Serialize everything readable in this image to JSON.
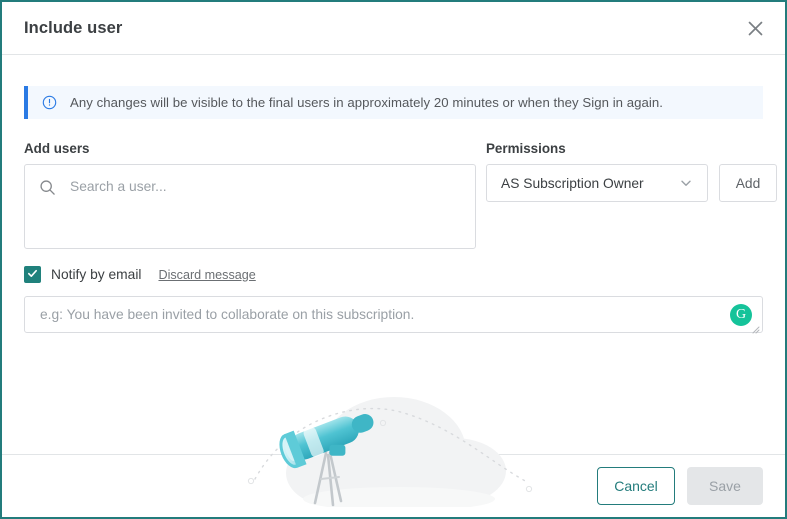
{
  "dialog": {
    "title": "Include user",
    "close_icon": "close-icon",
    "accent_color": "#237C7C"
  },
  "banner": {
    "icon": "info-circle-icon",
    "text": "Any changes will be visible to the final users in approximately 20 minutes or when they Sign in again.",
    "accent_color": "#2a7ae4",
    "background_color": "#f3f8fe"
  },
  "add_users": {
    "label": "Add users",
    "search_icon": "search-icon",
    "placeholder": "Search a user...",
    "value": ""
  },
  "permissions": {
    "label": "Permissions",
    "selected": "AS Subscription Owner",
    "chevron_icon": "chevron-down-icon",
    "add_label": "Add"
  },
  "notify": {
    "checkbox_checked": true,
    "check_icon": "check-icon",
    "label": "Notify by email",
    "discard_label": "Discard message",
    "checkbox_color": "#20817c"
  },
  "message": {
    "placeholder": "e.g: You have been invited to collaborate on this subscription.",
    "value": "",
    "assistant_badge": "G",
    "assistant_icon": "grammarly-icon",
    "assistant_color": "#15c39a",
    "resize_handle": "resize-grip-icon"
  },
  "illustration": {
    "name": "telescope-empty-state-illustration",
    "telescope_color": "#5ec8d4",
    "cloud_color": "#f2f3f4"
  },
  "footer": {
    "cancel_label": "Cancel",
    "save_label": "Save",
    "save_disabled": true
  }
}
